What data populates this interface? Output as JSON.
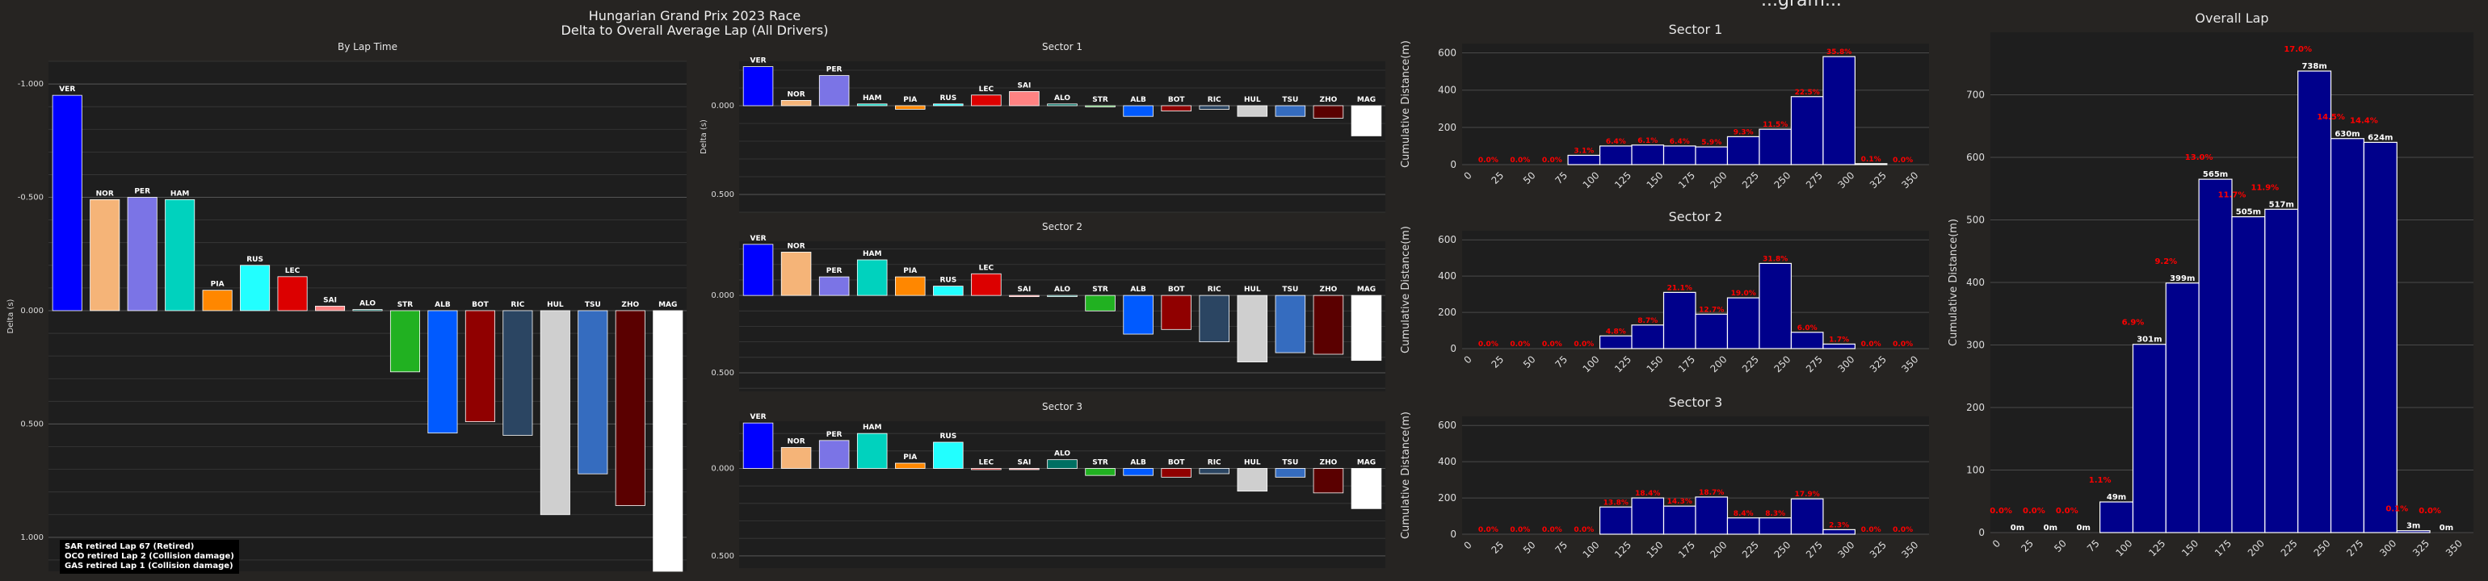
{
  "header": {
    "title_line1": "Hungarian Grand Prix 2023 Race",
    "title_line2": "Delta to Overall Average Lap (All Drivers)",
    "right_title_partial": "...gram..."
  },
  "retirements": [
    "SAR retired Lap 67 (Retired)",
    "OCO retired Lap 2 (Collision damage)",
    "GAS retired Lap 1 (Collision damage)"
  ],
  "colors": {
    "VER": "#0000ff",
    "NOR": "#f5b478",
    "PER": "#7b74e6",
    "HAM": "#00d2be",
    "PIA": "#ff8700",
    "RUS": "#22ffff",
    "LEC": "#dc0000",
    "SAI": "#ff8282",
    "ALO": "#006f62",
    "STR": "#21b121",
    "ALB": "#005aff",
    "BOT": "#900000",
    "RIC": "#2b4562",
    "HUL": "#cfcfcf",
    "TSU": "#356cbf",
    "ZHO": "#5a0000",
    "MAG": "#ffffff",
    "hist_bar": "#00008b",
    "pct_label": "#ff0000",
    "panel_bg": "#1e1e1e",
    "page_bg": "#262422"
  },
  "chart_data": [
    {
      "type": "bar",
      "name": "lap_time",
      "title": "By Lap Time",
      "ylabel": "Delta (s)",
      "xlabel": "",
      "ylim": [
        1.15,
        -1.1
      ],
      "yticks": [
        -1.0,
        -0.5,
        0.0,
        0.5,
        1.0
      ],
      "ytick_labels": [
        "-1.000",
        "-0.500",
        "0.000",
        "0.500",
        "1.000"
      ],
      "categories": [
        "VER",
        "NOR",
        "PER",
        "HAM",
        "PIA",
        "RUS",
        "LEC",
        "SAI",
        "ALO",
        "STR",
        "ALB",
        "BOT",
        "RIC",
        "HUL",
        "TSU",
        "ZHO",
        "MAG"
      ],
      "values": [
        -0.95,
        -0.49,
        -0.5,
        -0.49,
        -0.09,
        -0.2,
        -0.15,
        -0.02,
        -0.005,
        0.27,
        0.54,
        0.49,
        0.55,
        0.9,
        0.72,
        0.86,
        1.15
      ]
    },
    {
      "type": "bar",
      "name": "sector1",
      "title": "Sector 1",
      "ylabel": "Delta (s)",
      "xlabel": "",
      "ylim": [
        0.6,
        -0.25
      ],
      "yticks": [
        0.0,
        0.5
      ],
      "ytick_labels": [
        "0.000",
        "0.500"
      ],
      "categories": [
        "VER",
        "NOR",
        "PER",
        "HAM",
        "PIA",
        "RUS",
        "LEC",
        "SAI",
        "ALO",
        "STR",
        "ALB",
        "BOT",
        "RIC",
        "HUL",
        "TSU",
        "ZHO",
        "MAG"
      ],
      "values": [
        -0.22,
        -0.03,
        -0.17,
        -0.01,
        0.02,
        -0.01,
        -0.06,
        -0.08,
        -0.01,
        0.0,
        0.06,
        0.03,
        0.02,
        0.06,
        0.06,
        0.07,
        0.17
      ]
    },
    {
      "type": "bar",
      "name": "sector2",
      "title": "Sector 2",
      "ylabel": "",
      "xlabel": "",
      "ylim": [
        0.62,
        -0.35
      ],
      "yticks": [
        0.0,
        0.5
      ],
      "ytick_labels": [
        "0.000",
        "0.500"
      ],
      "categories": [
        "VER",
        "NOR",
        "PER",
        "HAM",
        "PIA",
        "RUS",
        "LEC",
        "SAI",
        "ALO",
        "STR",
        "ALB",
        "BOT",
        "RIC",
        "HUL",
        "TSU",
        "ZHO",
        "MAG"
      ],
      "values": [
        -0.33,
        -0.28,
        -0.12,
        -0.23,
        -0.12,
        -0.06,
        -0.14,
        0.0,
        0.0,
        0.1,
        0.25,
        0.22,
        0.3,
        0.43,
        0.37,
        0.38,
        0.42
      ]
    },
    {
      "type": "bar",
      "name": "sector3",
      "title": "Sector 3",
      "ylabel": "",
      "xlabel": "",
      "ylim": [
        0.57,
        -0.27
      ],
      "yticks": [
        0.0,
        0.5
      ],
      "ytick_labels": [
        "0.000",
        "0.500"
      ],
      "categories": [
        "VER",
        "NOR",
        "PER",
        "HAM",
        "PIA",
        "RUS",
        "LEC",
        "SAI",
        "ALO",
        "STR",
        "ALB",
        "BOT",
        "RIC",
        "HUL",
        "TSU",
        "ZHO",
        "MAG"
      ],
      "values": [
        -0.26,
        -0.12,
        -0.16,
        -0.2,
        -0.03,
        -0.15,
        0.0,
        0.0,
        -0.05,
        0.04,
        0.04,
        0.05,
        0.03,
        0.13,
        0.05,
        0.14,
        0.23
      ]
    },
    {
      "type": "bar",
      "name": "hist_s1",
      "title": "Sector 1",
      "ylabel": "Cumulative Distance(m)",
      "xlabel": "",
      "ylim": [
        0,
        650
      ],
      "yticks": [
        0,
        200,
        400,
        600
      ],
      "ytick_labels": [
        "0",
        "200",
        "400",
        "600"
      ],
      "categories": [
        "0",
        "25",
        "50",
        "75",
        "100",
        "125",
        "150",
        "175",
        "200",
        "225",
        "250",
        "275",
        "300",
        "325",
        "350"
      ],
      "values": [
        0,
        0,
        0,
        50,
        100,
        105,
        100,
        95,
        150,
        190,
        365,
        580,
        5,
        0
      ],
      "pct_labels": [
        "0.0%",
        "0.0%",
        "0.0%",
        "3.1%",
        "6.4%",
        "6.1%",
        "6.4%",
        "5.9%",
        "9.3%",
        "11.5%",
        "22.5%",
        "35.8%",
        "0.1%",
        "0.0%"
      ]
    },
    {
      "type": "bar",
      "name": "hist_s2",
      "title": "Sector 2",
      "ylabel": "Cumulative Distance(m)",
      "xlabel": "",
      "ylim": [
        0,
        650
      ],
      "yticks": [
        0,
        200,
        400,
        600
      ],
      "ytick_labels": [
        "0",
        "200",
        "400",
        "600"
      ],
      "categories": [
        "0",
        "25",
        "50",
        "75",
        "100",
        "125",
        "150",
        "175",
        "200",
        "225",
        "250",
        "275",
        "300",
        "325",
        "350"
      ],
      "values": [
        0,
        0,
        0,
        0,
        70,
        130,
        310,
        190,
        280,
        470,
        90,
        25,
        0,
        0
      ],
      "pct_labels": [
        "0.0%",
        "0.0%",
        "0.0%",
        "0.0%",
        "4.8%",
        "8.7%",
        "21.1%",
        "12.7%",
        "19.0%",
        "31.8%",
        "6.0%",
        "1.7%",
        "0.0%",
        "0.0%"
      ]
    },
    {
      "type": "bar",
      "name": "hist_s3",
      "title": "Sector 3",
      "ylabel": "Cumulative Distance(m)",
      "xlabel": "",
      "ylim": [
        0,
        650
      ],
      "yticks": [
        0,
        200,
        400,
        600
      ],
      "ytick_labels": [
        "0",
        "200",
        "400",
        "600"
      ],
      "categories": [
        "0",
        "25",
        "50",
        "75",
        "100",
        "125",
        "150",
        "175",
        "200",
        "225",
        "250",
        "275",
        "300",
        "325",
        "350"
      ],
      "values": [
        0,
        0,
        0,
        0,
        150,
        200,
        155,
        205,
        90,
        90,
        195,
        25,
        0,
        0
      ],
      "pct_labels": [
        "0.0%",
        "0.0%",
        "0.0%",
        "0.0%",
        "13.8%",
        "18.4%",
        "14.3%",
        "18.7%",
        "8.4%",
        "8.3%",
        "17.9%",
        "2.3%",
        "0.0%",
        "0.0%"
      ]
    },
    {
      "type": "bar",
      "name": "hist_overall",
      "title": "Overall Lap",
      "ylabel": "Cumulative Distance(m)",
      "xlabel": "",
      "ylim": [
        0,
        800
      ],
      "yticks": [
        0,
        100,
        200,
        300,
        400,
        500,
        600,
        700
      ],
      "ytick_labels": [
        "0",
        "100",
        "200",
        "300",
        "400",
        "500",
        "600",
        "700"
      ],
      "categories": [
        "0",
        "25",
        "50",
        "75",
        "100",
        "125",
        "150",
        "175",
        "200",
        "225",
        "250",
        "275",
        "300",
        "325",
        "350"
      ],
      "values": [
        0,
        0,
        0,
        49,
        301,
        399,
        565,
        505,
        517,
        738,
        630,
        624,
        3,
        0
      ],
      "value_labels": [
        "0m",
        "0m",
        "0m",
        "49m",
        "301m",
        "399m",
        "565m",
        "505m",
        "517m",
        "738m",
        "630m",
        "624m",
        "3m",
        "0m"
      ],
      "pct_labels": [
        "0.0%",
        "0.0%",
        "0.0%",
        "1.1%",
        "6.9%",
        "9.2%",
        "13.0%",
        "11.7%",
        "11.9%",
        "17.0%",
        "14.5%",
        "14.4%",
        "0.1%",
        "0.0%"
      ]
    }
  ]
}
